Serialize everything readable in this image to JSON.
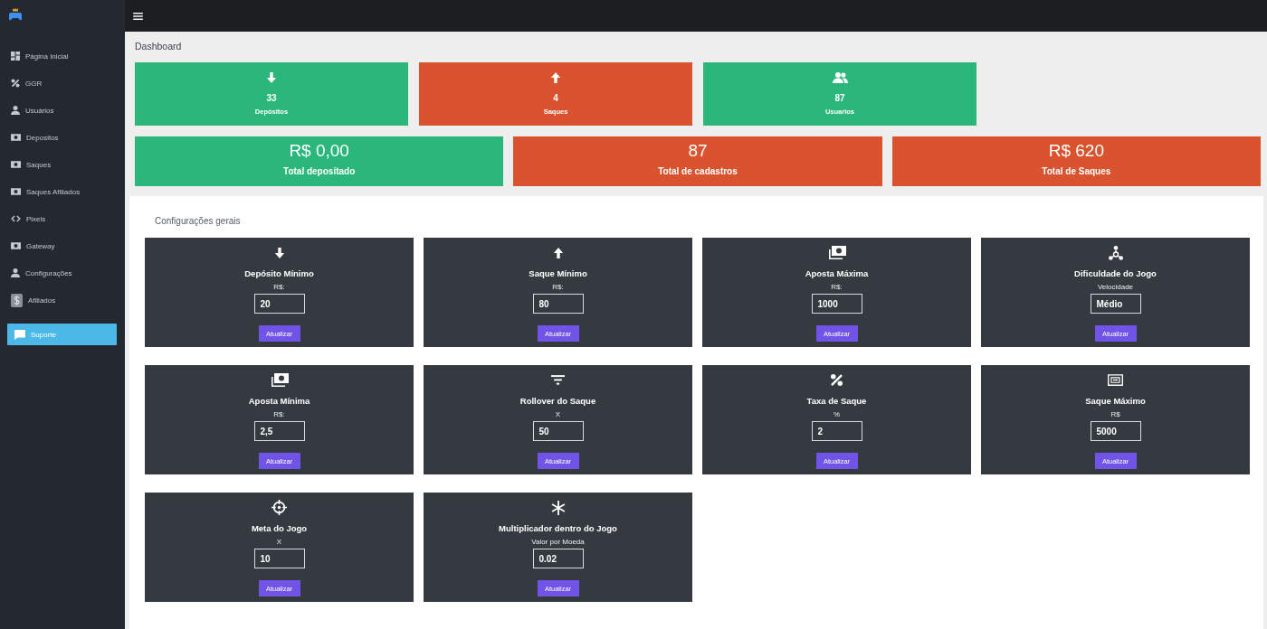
{
  "sidebar": {
    "items": [
      {
        "label": "Página Inicial",
        "selected": false
      },
      {
        "label": "GGR",
        "selected": false
      },
      {
        "label": "Usuários",
        "selected": false
      },
      {
        "label": "Depositos",
        "selected": false
      },
      {
        "label": "Saques",
        "selected": false
      },
      {
        "label": "Saques Afiliados",
        "selected": false
      },
      {
        "label": "Pixels",
        "selected": false
      },
      {
        "label": "Gateway",
        "selected": false
      },
      {
        "label": "Configurações",
        "selected": false
      },
      {
        "label": "Afiliados",
        "selected": false
      }
    ],
    "support_button": {
      "label": "Suporte"
    }
  },
  "page_title": "Dashboard",
  "stats": [
    {
      "value": "33",
      "label": "Depósitos",
      "color": "#2bb77b"
    },
    {
      "value": "4",
      "label": "Saques",
      "color": "#d9542e"
    },
    {
      "value": "87",
      "label": "Usuarios",
      "color": "#2bb77b"
    }
  ],
  "totals": [
    {
      "value": "R$ 0,00",
      "label": "Total depositado",
      "color": "#2bb77b"
    },
    {
      "value": "87",
      "label": "Total de cadastros",
      "color": "#d9542e"
    },
    {
      "value": "R$ 620",
      "label": "Total de Saques",
      "color": "#d9542e"
    }
  ],
  "settings": {
    "title": "Configurações gerais",
    "cards": [
      {
        "title": "Depósito Mínimo",
        "unit": "R$:",
        "value": "20",
        "button": "Atualizar"
      },
      {
        "title": "Saque Mínimo",
        "unit": "R$:",
        "value": "80",
        "button": "Atualizar"
      },
      {
        "title": "Aposta Máxima",
        "unit": "R$:",
        "value": "1000",
        "button": "Atualizar"
      },
      {
        "title": "Dificuldade do Jogo",
        "unit": "Velocidade",
        "value": "Médio",
        "button": "Atualizar"
      },
      {
        "title": "Aposta Mínima",
        "unit": "R$:",
        "value": "2,5",
        "button": "Atualizar"
      },
      {
        "title": "Rollover do Saque",
        "unit": "X",
        "value": "50",
        "button": "Atualizar"
      },
      {
        "title": "Taxa de Saque",
        "unit": "%",
        "value": "2",
        "button": "Atualizar"
      },
      {
        "title": "Saque Máximo",
        "unit": "R$",
        "value": "5000",
        "button": "Atualizar"
      },
      {
        "title": "Meta do Jogo",
        "unit": "X",
        "value": "10",
        "button": "Atualizar"
      },
      {
        "title": "Multiplicador dentro do Jogo",
        "unit": "Valor por Moeda",
        "value": "0.02",
        "button": "Atualizar"
      }
    ]
  }
}
